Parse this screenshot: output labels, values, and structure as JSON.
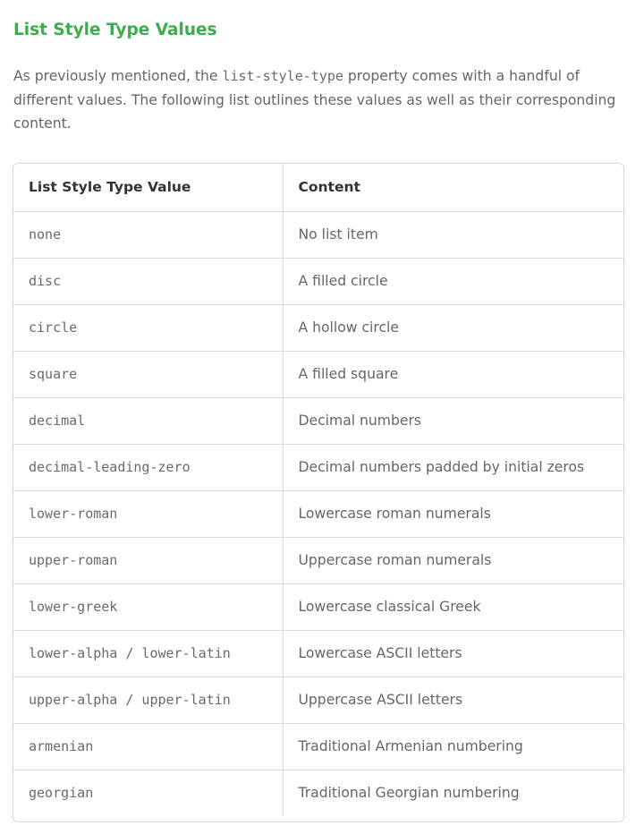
{
  "section": {
    "title": "List Style Type Values",
    "intro_before": "As previously mentioned, the ",
    "intro_code": "list-style-type",
    "intro_after": " property comes with a handful of different values. The following list outlines these values as well as their corresponding content."
  },
  "table": {
    "headers": [
      "List Style Type Value",
      "Content"
    ],
    "rows": [
      {
        "value": "none",
        "content": "No list item"
      },
      {
        "value": "disc",
        "content": "A filled circle"
      },
      {
        "value": "circle",
        "content": "A hollow circle"
      },
      {
        "value": "square",
        "content": "A filled square"
      },
      {
        "value": "decimal",
        "content": "Decimal numbers"
      },
      {
        "value": "decimal-leading-zero",
        "content": "Decimal numbers padded by initial zeros"
      },
      {
        "value": "lower-roman",
        "content": "Lowercase roman numerals"
      },
      {
        "value": "upper-roman",
        "content": "Uppercase roman numerals"
      },
      {
        "value": "lower-greek",
        "content": "Lowercase classical Greek"
      },
      {
        "value": "lower-alpha / lower-latin",
        "content": "Lowercase ASCII letters"
      },
      {
        "value": "upper-alpha / upper-latin",
        "content": "Uppercase ASCII letters"
      },
      {
        "value": "armenian",
        "content": "Traditional Armenian numbering"
      },
      {
        "value": "georgian",
        "content": "Traditional Georgian numbering"
      }
    ]
  },
  "colors": {
    "heading": "#3dac4f",
    "text": "#666666",
    "border": "#dcdcdc"
  }
}
